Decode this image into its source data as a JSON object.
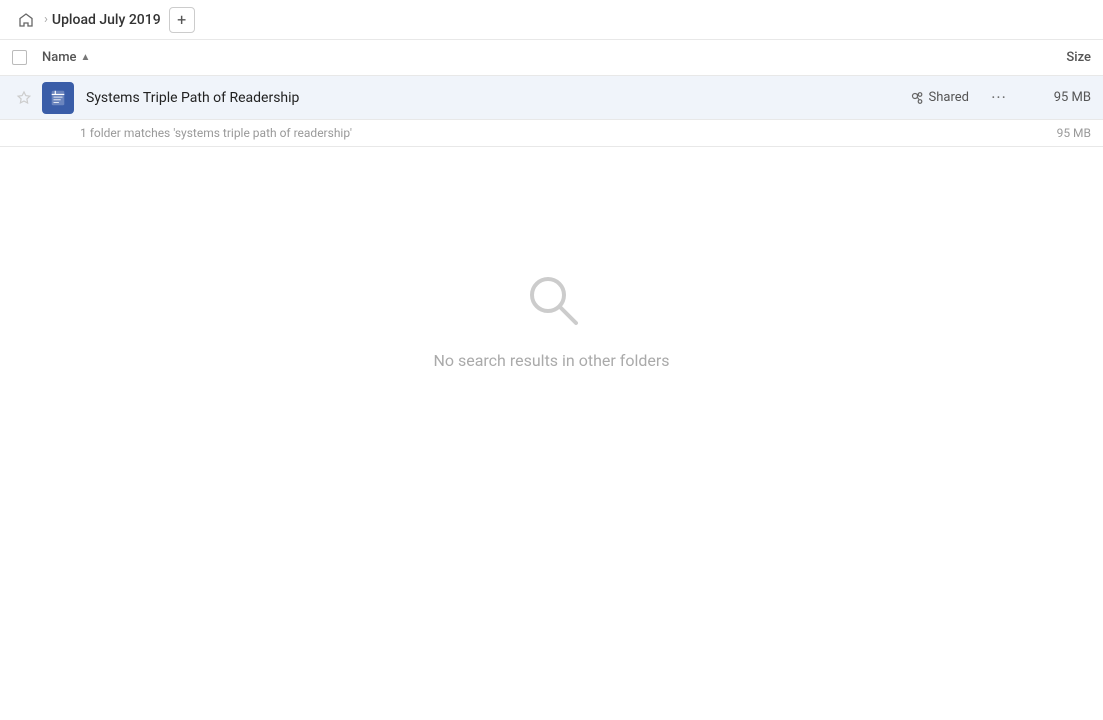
{
  "header": {
    "home_icon": "home",
    "breadcrumb_path": "Upload July 2019",
    "add_btn_label": "+"
  },
  "columns": {
    "name_label": "Name",
    "size_label": "Size",
    "sort_direction": "asc"
  },
  "file_row": {
    "name": "Systems Triple Path of Readership",
    "shared_label": "Shared",
    "size": "95 MB",
    "more_icon": "•••"
  },
  "match_info": {
    "text": "1 folder matches 'systems triple path of readership'",
    "size": "95 MB"
  },
  "empty_state": {
    "icon": "search",
    "message": "No search results in other folders"
  }
}
